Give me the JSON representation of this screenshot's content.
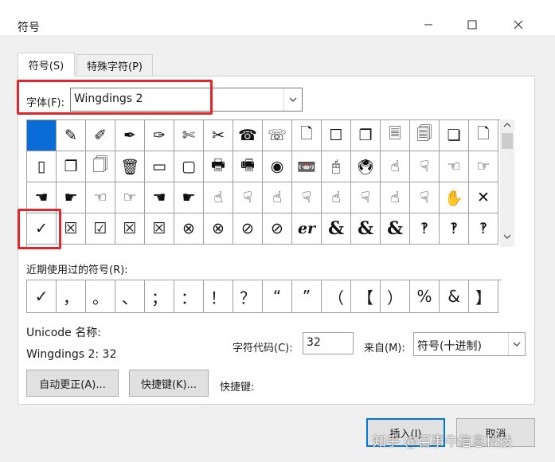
{
  "window": {
    "title": "符号",
    "controls": [
      "minimize-icon",
      "maximize-icon",
      "close-icon"
    ]
  },
  "tabs": [
    {
      "label": "符号(S)",
      "active": true
    },
    {
      "label": "特殊字符(P)",
      "active": false
    }
  ],
  "font": {
    "label": "字体(F):",
    "value": "Wingdings 2"
  },
  "symbol_grid": {
    "rows": [
      [
        "",
        "✎",
        "✐",
        "✒",
        "✑",
        "✄",
        "✂",
        "☎",
        "☏",
        "🗋",
        "☐",
        "❐",
        "🗏",
        "🗐",
        "❏",
        "🗋"
      ],
      [
        "▯",
        "❐",
        "🗍",
        "🗑",
        "▭",
        "▢",
        "🖶",
        "🖷",
        "◉",
        "📼",
        "🖰",
        "🖲",
        "☝",
        "☟",
        "☜",
        "☞"
      ],
      [
        "☚",
        "☛",
        "☜",
        "☞",
        "☚",
        "☛",
        "☝",
        "☟",
        "☝",
        "☟",
        "☝",
        "☟",
        "☝",
        "☟",
        "✋",
        "✕"
      ],
      [
        "✓",
        "☒",
        "☑",
        "☒",
        "☒",
        "⊗",
        "⊗",
        "⊘",
        "⊘",
        "er",
        "&",
        "&",
        "&",
        "‽",
        "‽",
        "‽"
      ]
    ],
    "selected_row": 0,
    "selected_col": 0
  },
  "recent": {
    "label": "近期使用过的符号(R):",
    "symbols": [
      "✓",
      "，",
      "。",
      "、",
      "；",
      "：",
      "！",
      "？",
      "“",
      "”",
      "（",
      "【",
      "）",
      "%",
      "&",
      "】"
    ]
  },
  "unicode": {
    "label": "Unicode 名称:",
    "value": "Wingdings 2: 32"
  },
  "char_code": {
    "label": "字符代码(C):",
    "value": "32"
  },
  "from": {
    "label": "来自(M):",
    "value": "符号(十进制)"
  },
  "buttons": {
    "autocorrect": "自动更正(A)...",
    "shortcut_key": "快捷键(K)...",
    "shortcut_label": "快捷键:",
    "insert": "插入(I)",
    "cancel": "取消"
  },
  "watermark": "知乎 @百事牛信息科技",
  "colors": {
    "highlight": "#e1272c",
    "selected_cell": "#0a6cd6",
    "default_button_border": "#0078d7"
  }
}
